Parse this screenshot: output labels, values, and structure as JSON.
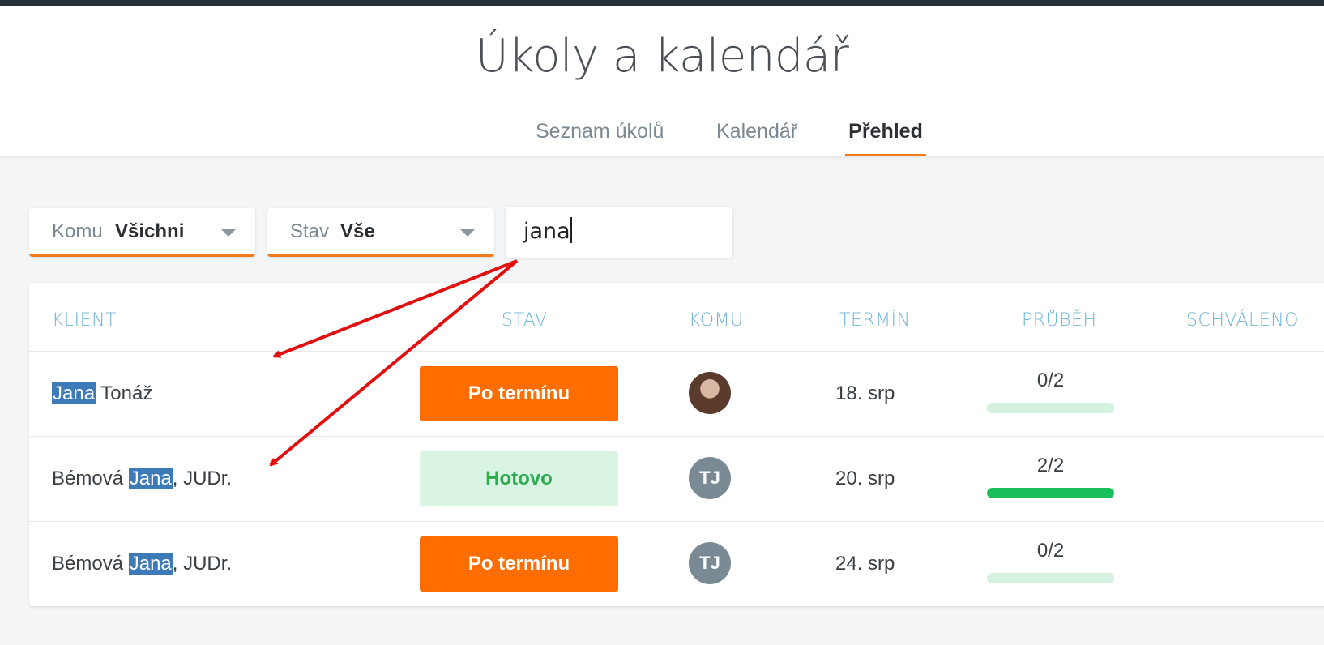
{
  "header": {
    "title": "Úkoly a kalendář",
    "tabs": [
      {
        "label": "Seznam úkolů",
        "active": false
      },
      {
        "label": "Kalendář",
        "active": false
      },
      {
        "label": "Přehled",
        "active": true
      }
    ]
  },
  "filters": {
    "assignee": {
      "label": "Komu",
      "value": "Všichni"
    },
    "state": {
      "label": "Stav",
      "value": "Vše"
    },
    "search": {
      "value": "jana"
    }
  },
  "table": {
    "columns": [
      "KLIENT",
      "STAV",
      "KOMU",
      "TERMÍN",
      "PRŮBĚH",
      "SCHVÁLENO"
    ],
    "rows": [
      {
        "client_before": "",
        "client_match": "Jana",
        "client_after": " Tonáž",
        "status": "Po termínu",
        "status_type": "overdue",
        "assignee": "",
        "assignee_icon": "avatar-photo",
        "deadline": "18. srp",
        "progress": "0/2",
        "progress_fraction": 0
      },
      {
        "client_before": "Bémová ",
        "client_match": "Jana",
        "client_after": ", JUDr.",
        "status": "Hotovo",
        "status_type": "done",
        "assignee": "TJ",
        "assignee_icon": "initials",
        "deadline": "20. srp",
        "progress": "2/2",
        "progress_fraction": 1
      },
      {
        "client_before": "Bémová ",
        "client_match": "Jana",
        "client_after": ", JUDr.",
        "status": "Po termínu",
        "status_type": "overdue",
        "assignee": "TJ",
        "assignee_icon": "initials",
        "deadline": "24. srp",
        "progress": "0/2",
        "progress_fraction": 0
      }
    ]
  },
  "colors": {
    "accent": "#f07a1c",
    "overdue": "#ff6d00",
    "done_bg": "#d9f4e3",
    "done_text": "#2eaa4f",
    "highlight": "#3d7ab8",
    "progress_fill": "#19c05a",
    "annotation_arrow": "#e01010"
  }
}
